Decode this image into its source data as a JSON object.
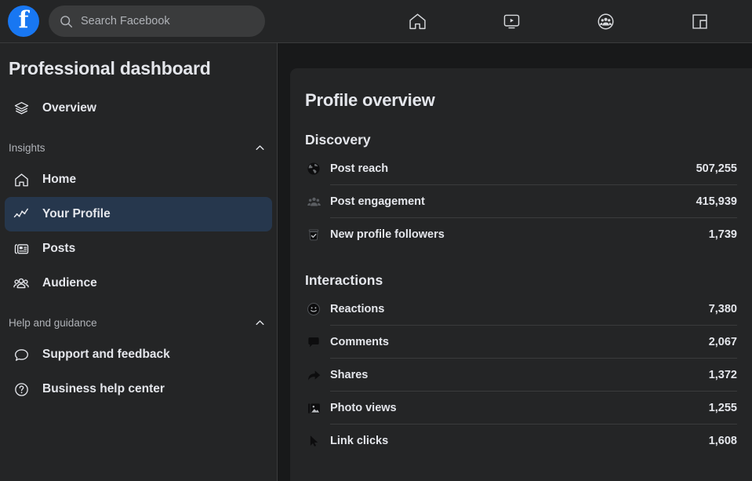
{
  "colors": {
    "brand_blue": "#1877f2",
    "surface": "#242526",
    "page_bg": "#18191a",
    "selected_row": "#26374d",
    "text_primary": "#e4e6eb",
    "text_secondary": "#b0b3b8",
    "divider": "#3a3b3c"
  },
  "topbar": {
    "logo_glyph": "f",
    "logo_name": "facebook-logo",
    "search": {
      "value": "",
      "placeholder": "Search Facebook",
      "icon": "search-icon"
    },
    "nav_icons": [
      {
        "name": "home-icon",
        "label": "Home"
      },
      {
        "name": "watch-video-icon",
        "label": "Video"
      },
      {
        "name": "groups-icon",
        "label": "Groups"
      },
      {
        "name": "gaming-icon",
        "label": "Gaming"
      }
    ]
  },
  "sidebar": {
    "title": "Professional dashboard",
    "overview": {
      "label": "Overview",
      "icon": "layers-icon"
    },
    "sections": [
      {
        "title": "Insights",
        "chevron": "chevron-up-icon",
        "items": [
          {
            "label": "Home",
            "icon": "house-icon",
            "selected": false
          },
          {
            "label": "Your Profile",
            "icon": "line-chart-icon",
            "selected": true
          },
          {
            "label": "Posts",
            "icon": "posts-icon",
            "selected": false
          },
          {
            "label": "Audience",
            "icon": "audience-icon",
            "selected": false
          }
        ]
      },
      {
        "title": "Help and guidance",
        "chevron": "chevron-up-icon",
        "items": [
          {
            "label": "Support and feedback",
            "icon": "speech-bubble-icon",
            "selected": false
          },
          {
            "label": "Business help center",
            "icon": "question-circle-icon",
            "selected": false
          }
        ]
      }
    ]
  },
  "main": {
    "title": "Profile overview",
    "groups": [
      {
        "title": "Discovery",
        "metrics": [
          {
            "label": "Post reach",
            "value": "507,255",
            "icon": "globe-icon"
          },
          {
            "label": "Post engagement",
            "value": "415,939",
            "icon": "people-icon"
          },
          {
            "label": "New profile followers",
            "value": "1,739",
            "icon": "badge-check-icon"
          }
        ]
      },
      {
        "title": "Interactions",
        "metrics": [
          {
            "label": "Reactions",
            "value": "7,380",
            "icon": "smiley-icon"
          },
          {
            "label": "Comments",
            "value": "2,067",
            "icon": "comment-bubble-icon"
          },
          {
            "label": "Shares",
            "value": "1,372",
            "icon": "share-arrow-icon"
          },
          {
            "label": "Photo views",
            "value": "1,255",
            "icon": "photo-icon"
          },
          {
            "label": "Link clicks",
            "value": "1,608",
            "icon": "cursor-arrow-icon"
          }
        ]
      }
    ]
  }
}
